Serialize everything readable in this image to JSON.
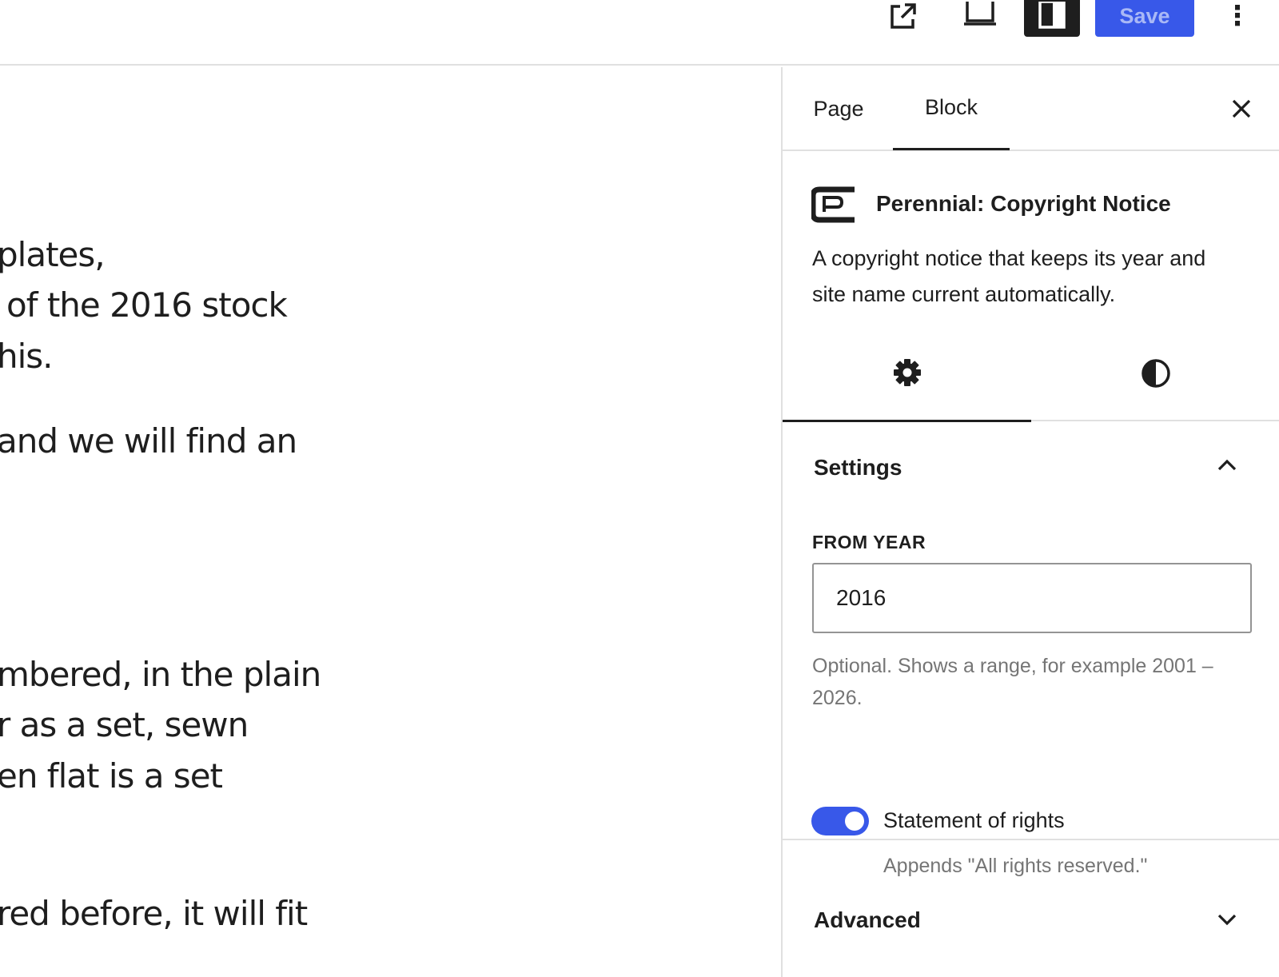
{
  "toolbar": {
    "save_label": "Save",
    "options_label": "⋮"
  },
  "canvas": {
    "lines": [
      "plates,",
      "of the 2016 stock",
      "his.",
      "and we will find an",
      "mbered, in the plain",
      "r as a set, sewn",
      "en flat is a set",
      "red before, it will fit"
    ]
  },
  "sidebar": {
    "tabs": [
      {
        "label": "Page"
      },
      {
        "label": "Block"
      }
    ],
    "active_tab": "Block",
    "block": {
      "title": "Perennial: Copyright Notice",
      "description": "A copyright notice that keeps its year and site name current automatically."
    },
    "settings_panel": {
      "title": "Settings",
      "expanded": true,
      "from_year": {
        "label": "FROM YEAR",
        "value": "2016",
        "help": "Optional. Shows a range, for example 2001 – 2026."
      },
      "rights": {
        "label": "Statement of rights",
        "checked": true,
        "help": "Appends \"All rights reserved.\""
      }
    },
    "advanced_panel": {
      "title": "Advanced",
      "expanded": false
    }
  },
  "colors": {
    "accent": "#3858e9",
    "text": "#1e1e1e",
    "muted": "#757575",
    "border": "#e0e0e0"
  }
}
